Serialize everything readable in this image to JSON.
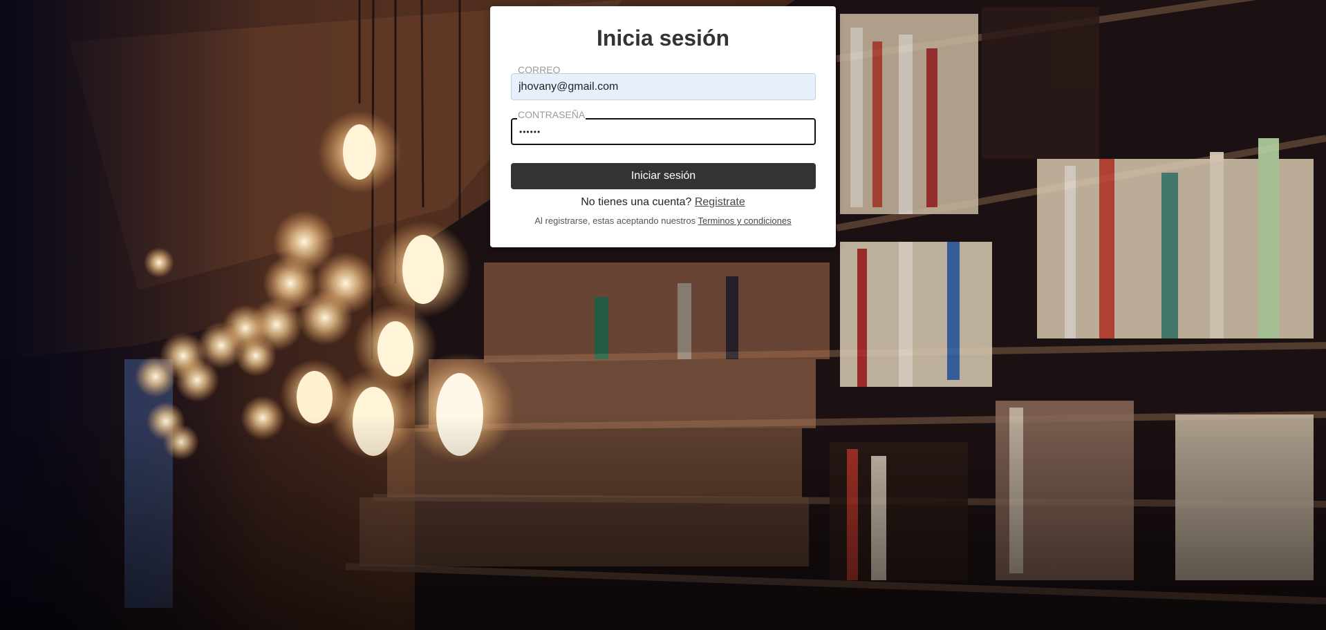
{
  "page": {
    "title": "Inicia sesión"
  },
  "form": {
    "email_label": "CORREO",
    "email_value": "jhovany@gmail.com",
    "password_label": "CONTRASEÑA",
    "password_value": "••••••",
    "submit_label": "Iniciar sesión"
  },
  "footer": {
    "signup_text": "No tienes una cuenta?",
    "signup_link": "Registrate",
    "terms_text": "Al registrarse, estas aceptando nuestros",
    "terms_link": "Terminos y condiciones"
  },
  "colors": {
    "card_bg": "#ffffff",
    "button_bg": "#333333",
    "autofill_bg": "#e8f0fe"
  },
  "background": {
    "subject": "library-bookshelves-with-hanging-bulbs"
  }
}
